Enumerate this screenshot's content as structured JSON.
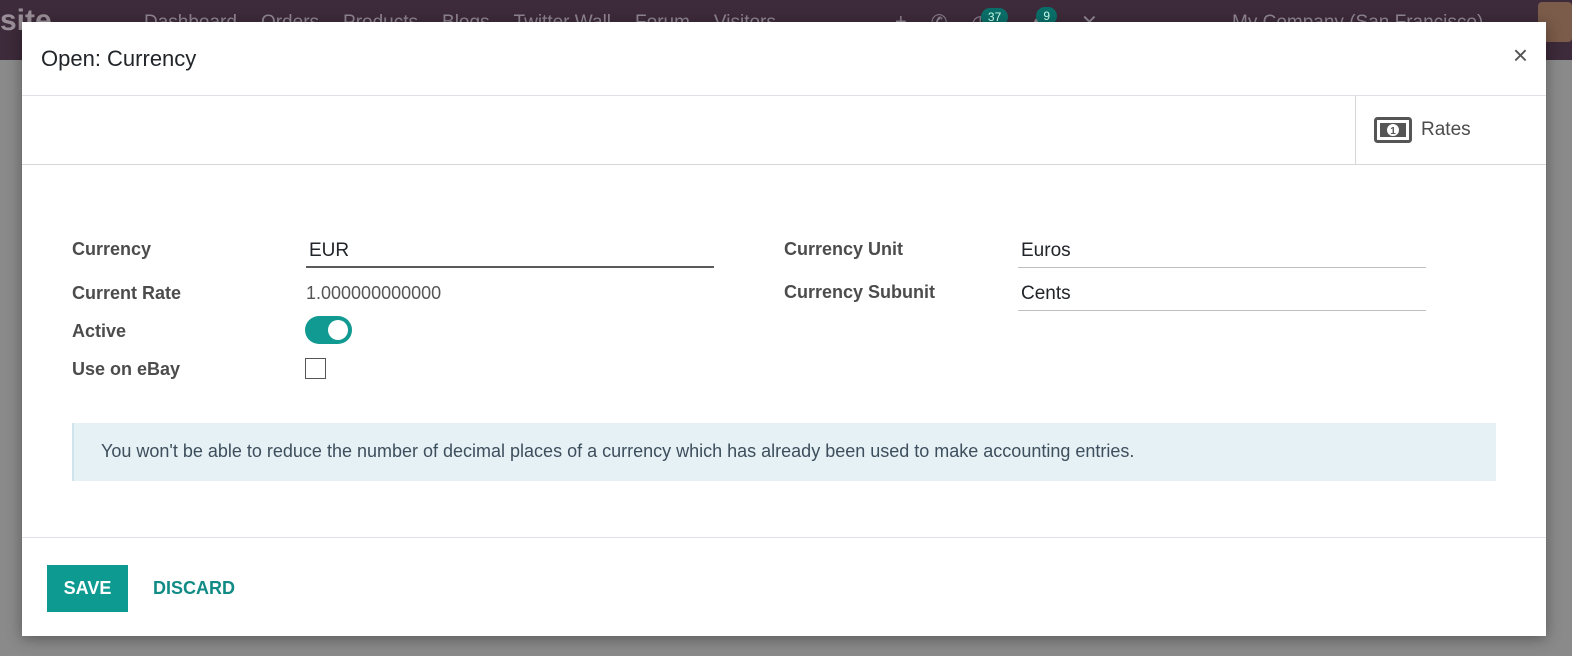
{
  "background_app": {
    "brand": "site",
    "menu": [
      "Dashboard",
      "Orders",
      "Products",
      "Blogs",
      "Twitter Wall",
      "Forum",
      "Visitors"
    ],
    "activity_count": "37",
    "messages_count": "9",
    "company": "My Company (San Francisco)"
  },
  "modal": {
    "title": "Open: Currency",
    "close_symbol": "×",
    "rates_label": "Rates",
    "fields": {
      "currency_label": "Currency",
      "currency_value": "EUR",
      "current_rate_label": "Current Rate",
      "current_rate_value": "1.000000000000",
      "active_label": "Active",
      "active_value": true,
      "ebay_label": "Use on eBay",
      "ebay_value": false,
      "unit_label": "Currency Unit",
      "unit_value": "Euros",
      "subunit_label": "Currency Subunit",
      "subunit_value": "Cents"
    },
    "alert": "You won't be able to reduce the number of decimal places of a currency which has already been used to make accounting entries.",
    "save_label": "SAVE",
    "discard_label": "DISCARD"
  },
  "colors": {
    "accent": "#0d9a91",
    "topbar": "#3d2a3a",
    "alert_bg": "#e6f1f6"
  }
}
